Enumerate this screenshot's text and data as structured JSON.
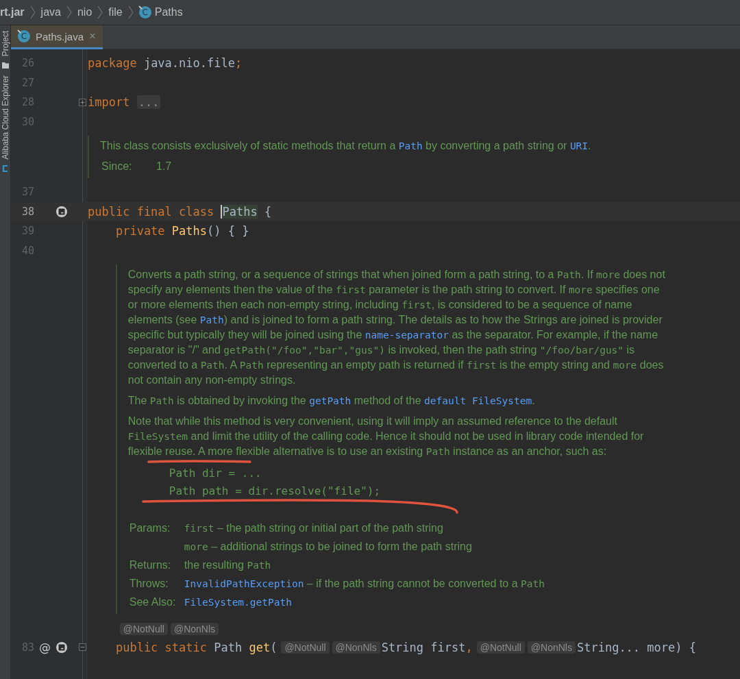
{
  "breadcrumbs": [
    {
      "label": "rt.jar",
      "kind": "jar"
    },
    {
      "label": "java",
      "kind": "package"
    },
    {
      "label": "nio",
      "kind": "package"
    },
    {
      "label": "file",
      "kind": "package"
    },
    {
      "label": "Paths",
      "kind": "class",
      "icon_letter": "C"
    }
  ],
  "tabs": [
    {
      "label": "Paths.java",
      "icon_letter": "C",
      "close": "×",
      "selected": true
    }
  ],
  "tool_windows": [
    {
      "label": "Project",
      "kind": "folder"
    },
    {
      "label": "Alibaba Cloud Explorer",
      "kind": "cloud"
    }
  ],
  "editor": {
    "lines": [
      {
        "kind": "code",
        "number": "26",
        "tokens": [
          {
            "text": "package ",
            "kind": "kw"
          },
          {
            "text": "java.nio.file",
            "kind": "plain"
          },
          {
            "text": ";",
            "kind": "kw"
          }
        ]
      },
      {
        "kind": "code",
        "number": "27"
      },
      {
        "kind": "code",
        "number": "28",
        "expanded": false,
        "tokens": [
          {
            "text": "import ",
            "kind": "kw"
          },
          {
            "text": "...",
            "kind": "folded"
          }
        ]
      },
      {
        "kind": "code",
        "number": "30"
      },
      {
        "kind": "doc",
        "paragraphs": [
          [
            {
              "text": "This class consists exclusively of static methods that return a ",
              "kind": "text"
            },
            {
              "text": "Path",
              "kind": "link"
            },
            {
              "text": " by converting a path string or ",
              "kind": "text"
            },
            {
              "text": "URI",
              "kind": "link"
            },
            {
              "text": ".",
              "kind": "text"
            }
          ]
        ],
        "tags": [
          {
            "label": "Since:",
            "entries": [
              [
                {
                  "text": "1.7",
                  "kind": "text"
                }
              ]
            ]
          }
        ]
      },
      {
        "kind": "code",
        "number": "37"
      },
      {
        "kind": "code",
        "number": "38",
        "current": true,
        "gutter_icons": [
          {
            "kind": "badge"
          }
        ],
        "tokens": [
          {
            "text": "public final class ",
            "kind": "kw"
          },
          {
            "text": "Paths",
            "kind": "usage",
            "caret": true
          },
          {
            "text": " {",
            "kind": "plain"
          }
        ],
        "children": [
          {
            "kind": "code",
            "number": "39",
            "tokens": [
              {
                "text": "private ",
                "kind": "kw"
              },
              {
                "text": "Paths",
                "kind": "fn"
              },
              {
                "text": "() { }",
                "kind": "plain"
              }
            ]
          },
          {
            "kind": "code",
            "number": "40"
          },
          {
            "kind": "doc",
            "pen_marks": [
              {
                "kind": "underline"
              },
              {
                "kind": "swoosh"
              }
            ],
            "paragraphs": [
              [
                {
                  "text": "Converts a path string, or a sequence of strings that when joined form a path string, to a ",
                  "kind": "text"
                },
                {
                  "text": "Path",
                  "kind": "code"
                },
                {
                  "text": ". If ",
                  "kind": "text"
                },
                {
                  "text": "more",
                  "kind": "code"
                },
                {
                  "text": " does not specify any elements then the value of the ",
                  "kind": "text"
                },
                {
                  "text": "first",
                  "kind": "code"
                },
                {
                  "text": " parameter is the path string to convert. If ",
                  "kind": "text"
                },
                {
                  "text": "more",
                  "kind": "code"
                },
                {
                  "text": " specifies one or more elements then each non-empty string, including ",
                  "kind": "text"
                },
                {
                  "text": "first",
                  "kind": "code"
                },
                {
                  "text": ", is considered to be a sequence of name elements (see ",
                  "kind": "text"
                },
                {
                  "text": "Path",
                  "kind": "link"
                },
                {
                  "text": ") and is joined to form a path string. The details as to how the Strings are joined is provider specific but typically they will be joined using the ",
                  "kind": "text"
                },
                {
                  "text": "name-separator",
                  "kind": "link"
                },
                {
                  "text": " as the separator. For example, if the name separator is \"/\" and ",
                  "kind": "text"
                },
                {
                  "text": "getPath(\"/foo\",\"bar\",\"gus\")",
                  "kind": "code"
                },
                {
                  "text": " is invoked, then the path string ",
                  "kind": "text"
                },
                {
                  "text": "\"/foo/bar/gus\"",
                  "kind": "code"
                },
                {
                  "text": " is converted to a ",
                  "kind": "text"
                },
                {
                  "text": "Path",
                  "kind": "code"
                },
                {
                  "text": ". A ",
                  "kind": "text"
                },
                {
                  "text": "Path",
                  "kind": "code"
                },
                {
                  "text": " representing an empty path is returned if ",
                  "kind": "text"
                },
                {
                  "text": "first",
                  "kind": "code"
                },
                {
                  "text": " is the empty string and ",
                  "kind": "text"
                },
                {
                  "text": "more",
                  "kind": "code"
                },
                {
                  "text": " does not contain any non-empty strings.",
                  "kind": "text"
                }
              ],
              [
                {
                  "text": "The ",
                  "kind": "text"
                },
                {
                  "text": "Path",
                  "kind": "code"
                },
                {
                  "text": " is obtained by invoking the ",
                  "kind": "text"
                },
                {
                  "text": "getPath",
                  "kind": "link"
                },
                {
                  "text": " method of the ",
                  "kind": "text"
                },
                {
                  "text": "default FileSystem",
                  "kind": "link"
                },
                {
                  "text": ".",
                  "kind": "text"
                }
              ],
              [
                {
                  "text": "Note that while this method is very convenient, using it will imply an assumed reference to the default ",
                  "kind": "text"
                },
                {
                  "text": "FileSystem",
                  "kind": "code"
                },
                {
                  "text": " and limit the utility of the calling code. Hence it should not be used in library code intended for flexible reuse. A more flexible alternative is to use an existing ",
                  "kind": "text"
                },
                {
                  "text": "Path",
                  "kind": "code"
                },
                {
                  "text": " instance as an anchor, such as:",
                  "kind": "text"
                }
              ]
            ],
            "code_example": [
              "Path dir = ...",
              "Path path = dir.resolve(\"file\");"
            ],
            "tags": [
              {
                "label": "Params:",
                "entries": [
                  [
                    {
                      "text": "first",
                      "kind": "code"
                    },
                    {
                      "text": " – the path string or initial part of the path string",
                      "kind": "text"
                    }
                  ],
                  [
                    {
                      "text": "more",
                      "kind": "code"
                    },
                    {
                      "text": " – additional strings to be joined to form the path string",
                      "kind": "text"
                    }
                  ]
                ]
              },
              {
                "label": "Returns:",
                "entries": [
                  [
                    {
                      "text": "the resulting ",
                      "kind": "text"
                    },
                    {
                      "text": "Path",
                      "kind": "code"
                    }
                  ]
                ]
              },
              {
                "label": "Throws:",
                "entries": [
                  [
                    {
                      "text": "InvalidPathException",
                      "kind": "link"
                    },
                    {
                      "text": " – if the path string cannot be converted to a ",
                      "kind": "text"
                    },
                    {
                      "text": "Path",
                      "kind": "code"
                    }
                  ]
                ]
              },
              {
                "label": "See Also:",
                "entries": [
                  [
                    {
                      "text": "FileSystem.getPath",
                      "kind": "link"
                    }
                  ]
                ]
              }
            ]
          },
          {
            "kind": "inlay",
            "hints": [
              "@NotNull",
              "@NonNls"
            ]
          },
          {
            "kind": "code",
            "number": "83",
            "expanded": true,
            "gutter_icons": [
              {
                "kind": "glyph",
                "text": "@"
              },
              {
                "kind": "badge"
              }
            ],
            "tokens": [
              {
                "text": "public static ",
                "kind": "kw"
              },
              {
                "text": "Path ",
                "kind": "plain"
              },
              {
                "text": "get",
                "kind": "fn"
              },
              {
                "text": "(",
                "kind": "plain"
              },
              {
                "text": "@NotNull",
                "kind": "hint"
              },
              {
                "text": "@NonNls",
                "kind": "hint"
              },
              {
                "text": "String first",
                "kind": "plain"
              },
              {
                "text": ",",
                "kind": "kw"
              },
              {
                "text": "@NotNull",
                "kind": "hint"
              },
              {
                "text": "@NonNls",
                "kind": "hint"
              },
              {
                "text": "String... more) {",
                "kind": "plain"
              }
            ]
          }
        ]
      }
    ]
  }
}
